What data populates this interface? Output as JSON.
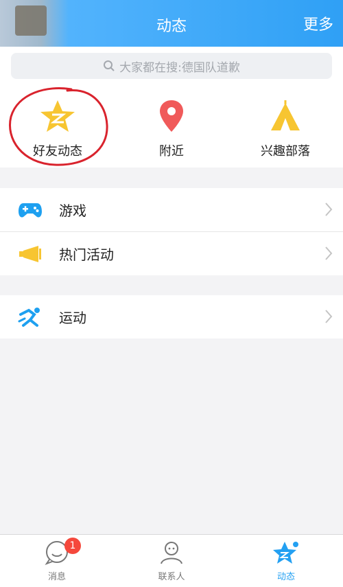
{
  "header": {
    "title": "动态",
    "more_label": "更多"
  },
  "search": {
    "placeholder": "大家都在搜:德国队道歉"
  },
  "quick": [
    {
      "label": "好友动态",
      "icon": "qzone-star-icon",
      "color": "#f7c531"
    },
    {
      "label": "附近",
      "icon": "location-pin-icon",
      "color": "#f05a5a"
    },
    {
      "label": "兴趣部落",
      "icon": "tent-icon",
      "color": "#f7c531"
    }
  ],
  "group1": [
    {
      "label": "游戏",
      "icon": "gamepad-icon"
    },
    {
      "label": "热门活动",
      "icon": "megaphone-icon"
    }
  ],
  "group2": [
    {
      "label": "运动",
      "icon": "runner-icon"
    }
  ],
  "tabs": [
    {
      "label": "消息",
      "icon": "message-bubble-icon",
      "badge": "1"
    },
    {
      "label": "联系人",
      "icon": "contacts-person-icon"
    },
    {
      "label": "动态",
      "icon": "star-dynamic-icon",
      "active": true
    }
  ],
  "colors": {
    "header": "#2fa0f5",
    "accent": "#23a0f2",
    "badge": "#f5483c",
    "annotation": "#d9232d"
  }
}
